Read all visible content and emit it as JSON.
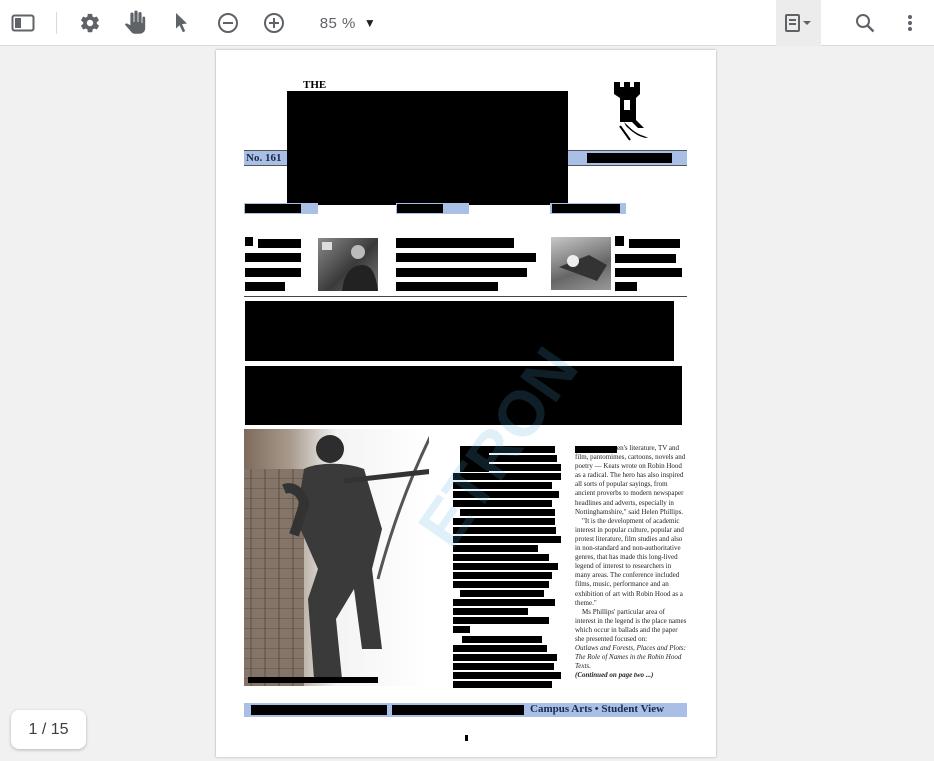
{
  "toolbar": {
    "zoom_label": "85 %",
    "page_indicator": "1 / 15",
    "icons": [
      "sidebar-toggle-icon",
      "settings-gear-icon",
      "hand-tool-icon",
      "pointer-tool-icon",
      "zoom-out-icon",
      "zoom-in-icon",
      "view-mode-icon",
      "search-icon",
      "more-vert-icon"
    ]
  },
  "newsletter": {
    "the": "THE",
    "issue": "No. 161",
    "body_start_suffix": "en's literature, TV and film, pantomimes, cartoons, novels and poetry — Keats wrote on Robin Hood as a radical. The hero has also inspired all sorts of popular sayings, from ancient proverbs to modern newspaper headlines and adverts, especially in Nottinghamshire,\" said Helen Phillips.",
    "para2": "\"It is the development of academic interest in popular culture, popular and protest literature, film studies and also in non-standard and non-authoritative genres, that has made this long-lived legend of interest to researchers in many areas. The conference included films, music, performance and an exhibition of art with Robin Hood as a theme.\"",
    "para3": "Ms Phillips' particular area of interest in the legend is the place names which occur in ballads and the paper she presented focused on:",
    "para3_italic": "Outlaws and Forests, Places and Plots: The Role of Names in the Robin Hood Texts.",
    "continued": "(Continued on page two ...)",
    "footer": "Campus Arts • Student View"
  },
  "colors": {
    "accent_blue": "#a9bfe6",
    "redaction": "#000000"
  }
}
